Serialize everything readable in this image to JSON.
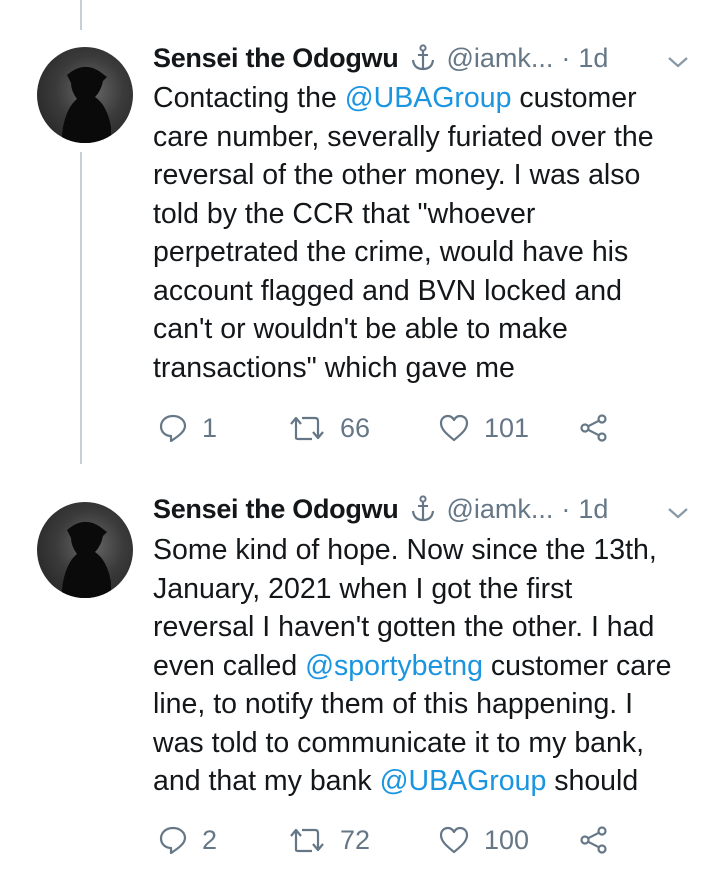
{
  "tweets": [
    {
      "author_name": "Sensei the Odogwu",
      "author_handle": "@iamk...",
      "separator": "·",
      "time": "1d",
      "lines": [
        [
          {
            "t": "Contacting the "
          },
          {
            "t": "@UBAGroup",
            "m": true
          },
          {
            "t": " customer"
          }
        ],
        [
          {
            "t": "care number, severally furiated over the"
          }
        ],
        [
          {
            "t": "reversal of the other money. I was also"
          }
        ],
        [
          {
            "t": "told by the CCR that \"whoever"
          }
        ],
        [
          {
            "t": "perpetrated the crime, would have his"
          }
        ],
        [
          {
            "t": "account flagged and BVN locked and"
          }
        ],
        [
          {
            "t": "can't or wouldn't be able to make"
          }
        ],
        [
          {
            "t": "transactions\" which gave me"
          }
        ]
      ],
      "replies": "1",
      "retweets": "66",
      "likes": "101"
    },
    {
      "author_name": "Sensei the Odogwu",
      "author_handle": "@iamk...",
      "separator": "·",
      "time": "1d",
      "lines": [
        [
          {
            "t": "Some kind of hope. Now since the 13th,"
          }
        ],
        [
          {
            "t": "January, 2021 when I got the first"
          }
        ],
        [
          {
            "t": "reversal I haven't gotten the other. I had"
          }
        ],
        [
          {
            "t": "even called "
          },
          {
            "t": "@sportybetng",
            "m": true
          },
          {
            "t": " customer care"
          }
        ],
        [
          {
            "t": "line, to notify them of this happening. I"
          }
        ],
        [
          {
            "t": "was told to communicate it to my bank,"
          }
        ],
        [
          {
            "t": "and that my bank "
          },
          {
            "t": "@UBAGroup",
            "m": true
          },
          {
            "t": " should"
          }
        ]
      ],
      "replies": "2",
      "retweets": "72",
      "likes": "100"
    }
  ],
  "icons": {
    "verified_emoji": "anchor-icon",
    "more": "chevron-down-icon",
    "reply": "reply-icon",
    "retweet": "retweet-icon",
    "like": "heart-icon",
    "share": "share-icon"
  },
  "colors": {
    "text": "#14171a",
    "muted": "#657786",
    "mention": "#1b95e0",
    "thread_line": "#c4cfd6"
  }
}
